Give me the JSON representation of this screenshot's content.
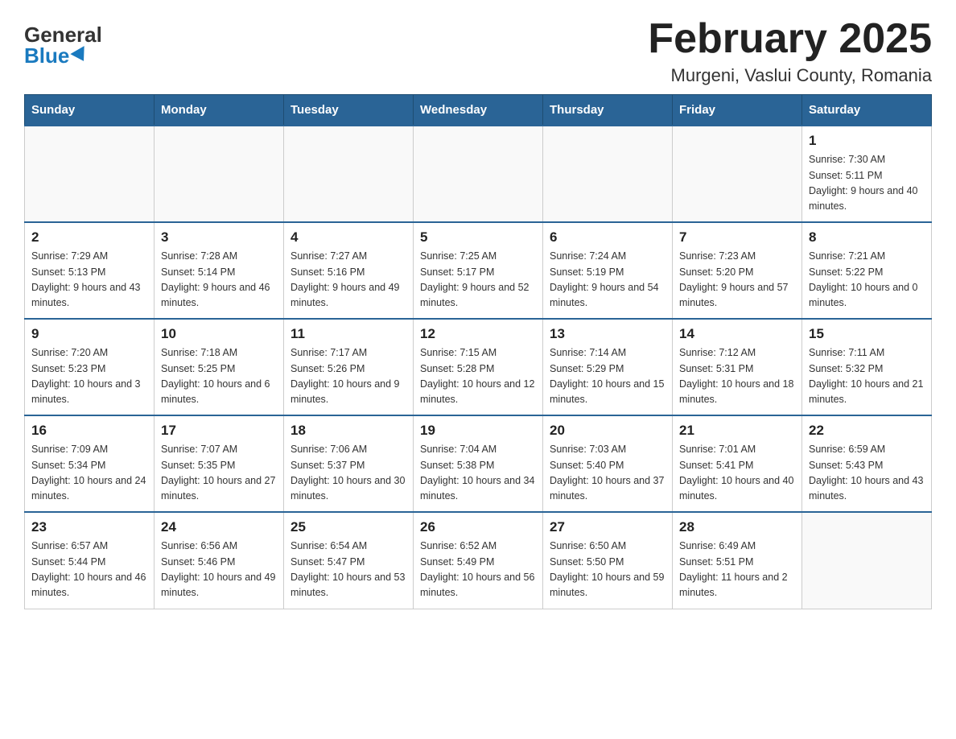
{
  "logo": {
    "general": "General",
    "blue": "Blue"
  },
  "title": "February 2025",
  "location": "Murgeni, Vaslui County, Romania",
  "days_of_week": [
    "Sunday",
    "Monday",
    "Tuesday",
    "Wednesday",
    "Thursday",
    "Friday",
    "Saturday"
  ],
  "weeks": [
    [
      {
        "day": "",
        "info": ""
      },
      {
        "day": "",
        "info": ""
      },
      {
        "day": "",
        "info": ""
      },
      {
        "day": "",
        "info": ""
      },
      {
        "day": "",
        "info": ""
      },
      {
        "day": "",
        "info": ""
      },
      {
        "day": "1",
        "info": "Sunrise: 7:30 AM\nSunset: 5:11 PM\nDaylight: 9 hours and 40 minutes."
      }
    ],
    [
      {
        "day": "2",
        "info": "Sunrise: 7:29 AM\nSunset: 5:13 PM\nDaylight: 9 hours and 43 minutes."
      },
      {
        "day": "3",
        "info": "Sunrise: 7:28 AM\nSunset: 5:14 PM\nDaylight: 9 hours and 46 minutes."
      },
      {
        "day": "4",
        "info": "Sunrise: 7:27 AM\nSunset: 5:16 PM\nDaylight: 9 hours and 49 minutes."
      },
      {
        "day": "5",
        "info": "Sunrise: 7:25 AM\nSunset: 5:17 PM\nDaylight: 9 hours and 52 minutes."
      },
      {
        "day": "6",
        "info": "Sunrise: 7:24 AM\nSunset: 5:19 PM\nDaylight: 9 hours and 54 minutes."
      },
      {
        "day": "7",
        "info": "Sunrise: 7:23 AM\nSunset: 5:20 PM\nDaylight: 9 hours and 57 minutes."
      },
      {
        "day": "8",
        "info": "Sunrise: 7:21 AM\nSunset: 5:22 PM\nDaylight: 10 hours and 0 minutes."
      }
    ],
    [
      {
        "day": "9",
        "info": "Sunrise: 7:20 AM\nSunset: 5:23 PM\nDaylight: 10 hours and 3 minutes."
      },
      {
        "day": "10",
        "info": "Sunrise: 7:18 AM\nSunset: 5:25 PM\nDaylight: 10 hours and 6 minutes."
      },
      {
        "day": "11",
        "info": "Sunrise: 7:17 AM\nSunset: 5:26 PM\nDaylight: 10 hours and 9 minutes."
      },
      {
        "day": "12",
        "info": "Sunrise: 7:15 AM\nSunset: 5:28 PM\nDaylight: 10 hours and 12 minutes."
      },
      {
        "day": "13",
        "info": "Sunrise: 7:14 AM\nSunset: 5:29 PM\nDaylight: 10 hours and 15 minutes."
      },
      {
        "day": "14",
        "info": "Sunrise: 7:12 AM\nSunset: 5:31 PM\nDaylight: 10 hours and 18 minutes."
      },
      {
        "day": "15",
        "info": "Sunrise: 7:11 AM\nSunset: 5:32 PM\nDaylight: 10 hours and 21 minutes."
      }
    ],
    [
      {
        "day": "16",
        "info": "Sunrise: 7:09 AM\nSunset: 5:34 PM\nDaylight: 10 hours and 24 minutes."
      },
      {
        "day": "17",
        "info": "Sunrise: 7:07 AM\nSunset: 5:35 PM\nDaylight: 10 hours and 27 minutes."
      },
      {
        "day": "18",
        "info": "Sunrise: 7:06 AM\nSunset: 5:37 PM\nDaylight: 10 hours and 30 minutes."
      },
      {
        "day": "19",
        "info": "Sunrise: 7:04 AM\nSunset: 5:38 PM\nDaylight: 10 hours and 34 minutes."
      },
      {
        "day": "20",
        "info": "Sunrise: 7:03 AM\nSunset: 5:40 PM\nDaylight: 10 hours and 37 minutes."
      },
      {
        "day": "21",
        "info": "Sunrise: 7:01 AM\nSunset: 5:41 PM\nDaylight: 10 hours and 40 minutes."
      },
      {
        "day": "22",
        "info": "Sunrise: 6:59 AM\nSunset: 5:43 PM\nDaylight: 10 hours and 43 minutes."
      }
    ],
    [
      {
        "day": "23",
        "info": "Sunrise: 6:57 AM\nSunset: 5:44 PM\nDaylight: 10 hours and 46 minutes."
      },
      {
        "day": "24",
        "info": "Sunrise: 6:56 AM\nSunset: 5:46 PM\nDaylight: 10 hours and 49 minutes."
      },
      {
        "day": "25",
        "info": "Sunrise: 6:54 AM\nSunset: 5:47 PM\nDaylight: 10 hours and 53 minutes."
      },
      {
        "day": "26",
        "info": "Sunrise: 6:52 AM\nSunset: 5:49 PM\nDaylight: 10 hours and 56 minutes."
      },
      {
        "day": "27",
        "info": "Sunrise: 6:50 AM\nSunset: 5:50 PM\nDaylight: 10 hours and 59 minutes."
      },
      {
        "day": "28",
        "info": "Sunrise: 6:49 AM\nSunset: 5:51 PM\nDaylight: 11 hours and 2 minutes."
      },
      {
        "day": "",
        "info": ""
      }
    ]
  ]
}
